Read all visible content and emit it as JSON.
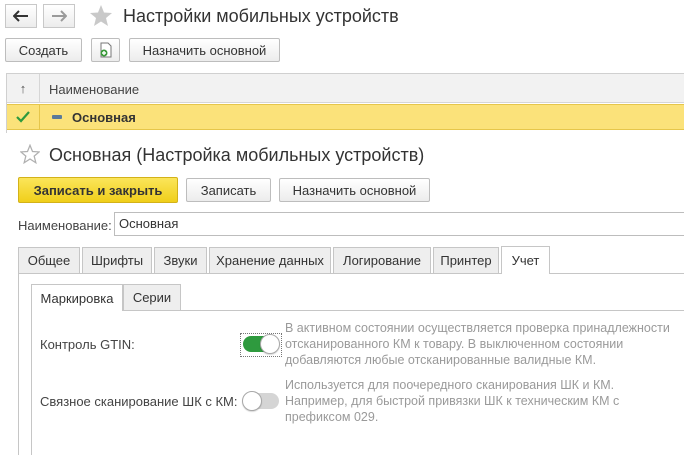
{
  "window": {
    "title": "Настройки мобильных устройств"
  },
  "toolbar": {
    "create_label": "Создать",
    "set_main_label": "Назначить основной"
  },
  "list": {
    "sort_glyph": "↑",
    "column_name": "Наименование",
    "rows": [
      {
        "name": "Основная",
        "selected": true
      }
    ]
  },
  "form": {
    "title": "Основная (Настройка мобильных устройств)",
    "save_close_label": "Записать и закрыть",
    "save_label": "Записать",
    "set_main_label": "Назначить основной",
    "name_label": "Наименование:",
    "name_value": "Основная",
    "tabs": [
      "Общее",
      "Шрифты",
      "Звуки",
      "Хранение данных",
      "Логирование",
      "Принтер",
      "Учет"
    ],
    "active_tab": "Учет",
    "subtabs": [
      "Маркировка",
      "Серии"
    ],
    "active_subtab": "Маркировка",
    "fields": [
      {
        "label": "Контроль GTIN:",
        "on": true,
        "hint": "В активном состоянии осуществляется проверка принадлежности отсканированного КМ к товару. В выключенном состоянии добавляются любые отсканированные валидные КМ."
      },
      {
        "label": "Связное сканирование ШК с КМ:",
        "on": false,
        "hint": "Используется для поочередного сканирования ШК и КМ. Например, для быстрой привязки ШК к техническим КМ с префиксом 029."
      }
    ]
  },
  "icons": {
    "back": "arrow-left-icon",
    "forward": "arrow-right-icon",
    "favorite": "star-icon",
    "checkmark": "checkmark-icon",
    "minus": "minus-icon"
  },
  "colors": {
    "accent_yellow": "#f0cf1a",
    "selected_row": "#fbe27a",
    "toggle_on": "#2e9a3e",
    "toggle_off": "#d5d5d5",
    "check_green": "#2e9a3e"
  }
}
